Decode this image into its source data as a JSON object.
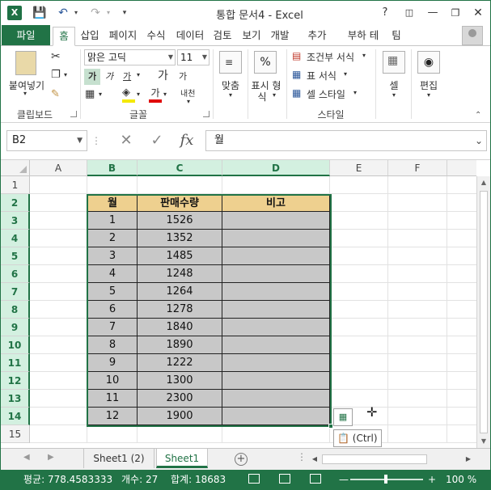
{
  "window": {
    "title": "통합 문서4 - Excel",
    "help_label": "?",
    "logo_label": "X"
  },
  "tabs": [
    "파일",
    "홈",
    "삽입",
    "페이지",
    "수식",
    "데이터",
    "검토",
    "보기",
    "개발",
    "추가",
    "부하 테",
    "팀"
  ],
  "ribbon": {
    "clipboard": {
      "paste_label": "붙여넣기",
      "group_label": "클립보드"
    },
    "font": {
      "font_name": "맑은 고딕",
      "font_size": "11",
      "group_label": "글꼴",
      "bold": "가",
      "italic": "가",
      "underline": "가",
      "grow": "가",
      "shrink": "가",
      "font_color": "가",
      "phonetic": "내천"
    },
    "alignment": {
      "label": "맞춤"
    },
    "number": {
      "label_line1": "표시 형",
      "label_line2": "식",
      "percent": "%"
    },
    "styles": {
      "conditional": "조건부 서식",
      "table": "표 서식",
      "cell_style": "셀 스타일",
      "group_label": "스타일"
    },
    "cells": {
      "label": "셀"
    },
    "editing": {
      "label": "편집"
    }
  },
  "formula_bar": {
    "name_box": "B2",
    "formula": "월"
  },
  "grid": {
    "columns": [
      "A",
      "B",
      "C",
      "D",
      "E",
      "F"
    ],
    "rows": [
      "1",
      "2",
      "3",
      "4",
      "5",
      "6",
      "7",
      "8",
      "9",
      "10",
      "11",
      "12",
      "13",
      "14",
      "15"
    ],
    "table": {
      "headers": [
        "월",
        "판매수량",
        "비고"
      ],
      "rows": [
        [
          "1",
          "1526",
          ""
        ],
        [
          "2",
          "1352",
          ""
        ],
        [
          "3",
          "1485",
          ""
        ],
        [
          "4",
          "1248",
          ""
        ],
        [
          "5",
          "1264",
          ""
        ],
        [
          "6",
          "1278",
          ""
        ],
        [
          "7",
          "1840",
          ""
        ],
        [
          "8",
          "1890",
          ""
        ],
        [
          "9",
          "1222",
          ""
        ],
        [
          "10",
          "1300",
          ""
        ],
        [
          "11",
          "2300",
          ""
        ],
        [
          "12",
          "1900",
          ""
        ]
      ]
    },
    "paste_options_label": "(Ctrl)"
  },
  "sheets": [
    "Sheet1 (2)",
    "Sheet1"
  ],
  "status": {
    "average": "평균: 778.4583333",
    "count": "개수: 27",
    "sum": "합계: 18683",
    "zoom": "100 %"
  },
  "colors": {
    "accent": "#217346",
    "header_fill": "#eed08f",
    "body_fill": "#c8c8c8"
  }
}
